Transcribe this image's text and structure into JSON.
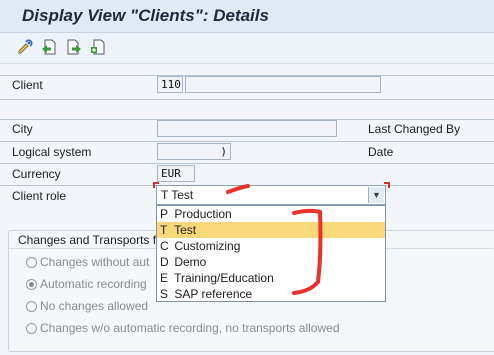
{
  "title": "Display View \"Clients\": Details",
  "toolbar": {
    "icons": [
      "display-change-icon",
      "previous-entry-icon",
      "next-entry-icon",
      "other-entry-icon"
    ]
  },
  "fields": {
    "client_label": "Client",
    "client_value": "110",
    "client_name": "",
    "city_label": "City",
    "city_value": "",
    "logical_system_label": "Logical system",
    "logical_system_value": ")",
    "currency_label": "Currency",
    "currency_value": "EUR",
    "client_role_label": "Client role",
    "client_role_value": "T Test",
    "last_changed_by_label": "Last Changed By",
    "date_label": "Date"
  },
  "dropdown": {
    "options": [
      {
        "key": "P",
        "label": "Production"
      },
      {
        "key": "T",
        "label": "Test",
        "selected": true
      },
      {
        "key": "C",
        "label": "Customizing"
      },
      {
        "key": "D",
        "label": "Demo"
      },
      {
        "key": "E",
        "label": "Training/Education"
      },
      {
        "key": "S",
        "label": "SAP reference"
      }
    ]
  },
  "group": {
    "title": "Changes and Transports f",
    "options": [
      {
        "label": "Changes without aut",
        "checked": false
      },
      {
        "label": "Automatic recording",
        "checked": true
      },
      {
        "label": "No changes allowed",
        "checked": false
      },
      {
        "label": "Changes w/o automatic recording, no transports allowed",
        "checked": false
      }
    ]
  },
  "colors": {
    "annotation": "#e8322b",
    "selected_option": "#f9d87a"
  }
}
